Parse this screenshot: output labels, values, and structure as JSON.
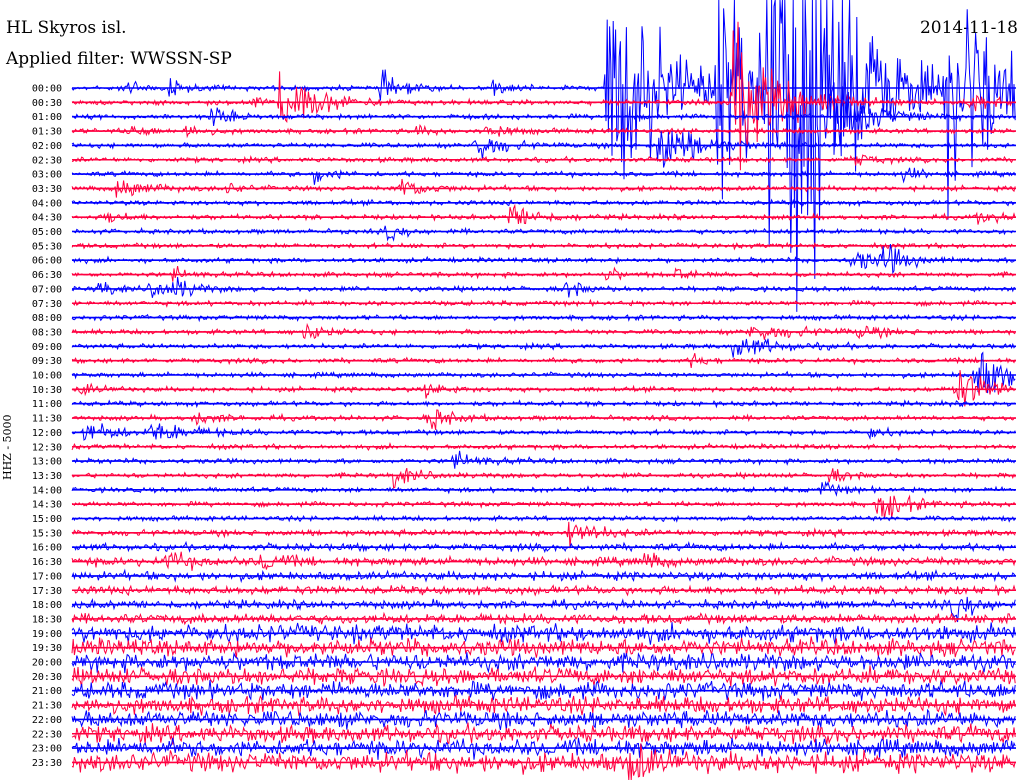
{
  "header": {
    "station": "HL Skyros isl.",
    "filter": "Applied filter: WWSSN-SP",
    "date": "2014-11-18",
    "channel": "HHZ - 5000"
  },
  "colors": {
    "blue": "#0000ff",
    "red": "#ff0040"
  },
  "chart_data": {
    "type": "line",
    "title": "HL Skyros isl.",
    "subtitle": "Applied filter: WWSSN-SP",
    "ylabel": "HHZ - 5000",
    "xlabel": "",
    "trace_interval_minutes": 30,
    "color_cycle": [
      "blue",
      "red"
    ],
    "traces": [
      {
        "label": "00:00",
        "noise": 2
      },
      {
        "label": "00:30",
        "noise": 2
      },
      {
        "label": "01:00",
        "noise": 2
      },
      {
        "label": "01:30",
        "noise": 2
      },
      {
        "label": "02:00",
        "noise": 2
      },
      {
        "label": "02:30",
        "noise": 2
      },
      {
        "label": "03:00",
        "noise": 2
      },
      {
        "label": "03:30",
        "noise": 2
      },
      {
        "label": "04:00",
        "noise": 2
      },
      {
        "label": "04:30",
        "noise": 2
      },
      {
        "label": "05:00",
        "noise": 2
      },
      {
        "label": "05:30",
        "noise": 2
      },
      {
        "label": "06:00",
        "noise": 2
      },
      {
        "label": "06:30",
        "noise": 2
      },
      {
        "label": "07:00",
        "noise": 2
      },
      {
        "label": "07:30",
        "noise": 2
      },
      {
        "label": "08:00",
        "noise": 2
      },
      {
        "label": "08:30",
        "noise": 2
      },
      {
        "label": "09:00",
        "noise": 2
      },
      {
        "label": "09:30",
        "noise": 2
      },
      {
        "label": "10:00",
        "noise": 2
      },
      {
        "label": "10:30",
        "noise": 2
      },
      {
        "label": "11:00",
        "noise": 2
      },
      {
        "label": "11:30",
        "noise": 2
      },
      {
        "label": "12:00",
        "noise": 2
      },
      {
        "label": "12:30",
        "noise": 2
      },
      {
        "label": "13:00",
        "noise": 2
      },
      {
        "label": "13:30",
        "noise": 2
      },
      {
        "label": "14:00",
        "noise": 2
      },
      {
        "label": "14:30",
        "noise": 2
      },
      {
        "label": "15:00",
        "noise": 2
      },
      {
        "label": "15:30",
        "noise": 2.5
      },
      {
        "label": "16:00",
        "noise": 3
      },
      {
        "label": "16:30",
        "noise": 3.5
      },
      {
        "label": "17:00",
        "noise": 3.5
      },
      {
        "label": "17:30",
        "noise": 3.5
      },
      {
        "label": "18:00",
        "noise": 3.5
      },
      {
        "label": "18:30",
        "noise": 4
      },
      {
        "label": "19:00",
        "noise": 7
      },
      {
        "label": "19:30",
        "noise": 7
      },
      {
        "label": "20:00",
        "noise": 7
      },
      {
        "label": "20:30",
        "noise": 7
      },
      {
        "label": "21:00",
        "noise": 7
      },
      {
        "label": "21:30",
        "noise": 7
      },
      {
        "label": "22:00",
        "noise": 7
      },
      {
        "label": "22:30",
        "noise": 7
      },
      {
        "label": "23:00",
        "noise": 7
      },
      {
        "label": "23:30",
        "noise": 8
      }
    ],
    "events": [
      {
        "trace": 0,
        "minute": 1.7,
        "amp": 8,
        "dur": 0.5
      },
      {
        "trace": 0,
        "minute": 3.1,
        "amp": 7,
        "dur": 0.4
      },
      {
        "trace": 0,
        "minute": 9.8,
        "amp": 12,
        "dur": 0.6
      },
      {
        "trace": 0,
        "minute": 13.4,
        "amp": 7,
        "dur": 0.4
      },
      {
        "trace": 0,
        "minute": 17.0,
        "amp": 120,
        "dur": 1.5
      },
      {
        "trace": 0,
        "minute": 20.5,
        "amp": 110,
        "dur": 1.5
      },
      {
        "trace": 0,
        "minute": 22.1,
        "amp": 130,
        "dur": 1.8
      },
      {
        "trace": 0,
        "minute": 22.9,
        "amp": 120,
        "dur": 1.5
      },
      {
        "trace": 0,
        "minute": 27.8,
        "amp": 130,
        "dur": 1.4
      },
      {
        "trace": 1,
        "minute": 6.6,
        "amp": 30,
        "dur": 1.0
      },
      {
        "trace": 1,
        "minute": 5.7,
        "amp": 6,
        "dur": 0.4
      },
      {
        "trace": 1,
        "minute": 21.0,
        "amp": 70,
        "dur": 1.2
      },
      {
        "trace": 1,
        "minute": 28.5,
        "amp": 10,
        "dur": 0.6
      },
      {
        "trace": 2,
        "minute": 4.4,
        "amp": 10,
        "dur": 0.5
      },
      {
        "trace": 2,
        "minute": 24.0,
        "amp": 40,
        "dur": 1.0
      },
      {
        "trace": 3,
        "minute": 1.8,
        "amp": 6,
        "dur": 0.5
      },
      {
        "trace": 3,
        "minute": 3.6,
        "amp": 6,
        "dur": 0.5
      },
      {
        "trace": 3,
        "minute": 10.9,
        "amp": 5,
        "dur": 0.4
      },
      {
        "trace": 3,
        "minute": 13.1,
        "amp": 8,
        "dur": 0.6
      },
      {
        "trace": 4,
        "minute": 12.8,
        "amp": 15,
        "dur": 0.7
      },
      {
        "trace": 4,
        "minute": 18.6,
        "amp": 30,
        "dur": 1.0
      },
      {
        "trace": 5,
        "minute": 24.8,
        "amp": 7,
        "dur": 0.5
      },
      {
        "trace": 6,
        "minute": 7.7,
        "amp": 8,
        "dur": 0.5
      },
      {
        "trace": 6,
        "minute": 26.4,
        "amp": 6,
        "dur": 0.5
      },
      {
        "trace": 7,
        "minute": 1.4,
        "amp": 10,
        "dur": 0.8
      },
      {
        "trace": 7,
        "minute": 4.9,
        "amp": 5,
        "dur": 0.4
      },
      {
        "trace": 7,
        "minute": 10.4,
        "amp": 10,
        "dur": 0.7
      },
      {
        "trace": 9,
        "minute": 1.1,
        "amp": 7,
        "dur": 0.5
      },
      {
        "trace": 9,
        "minute": 13.9,
        "amp": 12,
        "dur": 0.8
      },
      {
        "trace": 9,
        "minute": 28.8,
        "amp": 6,
        "dur": 0.5
      },
      {
        "trace": 10,
        "minute": 10.0,
        "amp": 7,
        "dur": 0.5
      },
      {
        "trace": 12,
        "minute": 24.8,
        "amp": 10,
        "dur": 0.8
      },
      {
        "trace": 12,
        "minute": 25.8,
        "amp": 12,
        "dur": 0.6
      },
      {
        "trace": 13,
        "minute": 3.2,
        "amp": 6,
        "dur": 0.4
      },
      {
        "trace": 13,
        "minute": 17.0,
        "amp": 6,
        "dur": 0.4
      },
      {
        "trace": 13,
        "minute": 19.2,
        "amp": 6,
        "dur": 0.4
      },
      {
        "trace": 14,
        "minute": 0.8,
        "amp": 7,
        "dur": 0.5
      },
      {
        "trace": 14,
        "minute": 2.5,
        "amp": 8,
        "dur": 0.6
      },
      {
        "trace": 14,
        "minute": 3.2,
        "amp": 8,
        "dur": 0.6
      },
      {
        "trace": 14,
        "minute": 15.7,
        "amp": 8,
        "dur": 0.5
      },
      {
        "trace": 17,
        "minute": 7.4,
        "amp": 8,
        "dur": 0.5
      },
      {
        "trace": 17,
        "minute": 21.5,
        "amp": 7,
        "dur": 1.5
      },
      {
        "trace": 17,
        "minute": 25.0,
        "amp": 5,
        "dur": 0.6
      },
      {
        "trace": 18,
        "minute": 21.0,
        "amp": 10,
        "dur": 1.2
      },
      {
        "trace": 19,
        "minute": 19.7,
        "amp": 6,
        "dur": 0.4
      },
      {
        "trace": 20,
        "minute": 28.7,
        "amp": 25,
        "dur": 1.0
      },
      {
        "trace": 21,
        "minute": 0.3,
        "amp": 6,
        "dur": 0.4
      },
      {
        "trace": 21,
        "minute": 11.2,
        "amp": 6,
        "dur": 0.6
      },
      {
        "trace": 21,
        "minute": 28.0,
        "amp": 20,
        "dur": 1.0
      },
      {
        "trace": 23,
        "minute": 3.8,
        "amp": 5,
        "dur": 0.8
      },
      {
        "trace": 23,
        "minute": 11.3,
        "amp": 12,
        "dur": 0.6
      },
      {
        "trace": 24,
        "minute": 0.4,
        "amp": 8,
        "dur": 1.0
      },
      {
        "trace": 24,
        "minute": 2.5,
        "amp": 8,
        "dur": 1.2
      },
      {
        "trace": 24,
        "minute": 25.3,
        "amp": 6,
        "dur": 0.4
      },
      {
        "trace": 26,
        "minute": 12.1,
        "amp": 7,
        "dur": 0.8
      },
      {
        "trace": 27,
        "minute": 10.2,
        "amp": 10,
        "dur": 0.6
      },
      {
        "trace": 27,
        "minute": 24.1,
        "amp": 6,
        "dur": 0.5
      },
      {
        "trace": 28,
        "minute": 23.8,
        "amp": 7,
        "dur": 0.5
      },
      {
        "trace": 29,
        "minute": 25.6,
        "amp": 15,
        "dur": 0.8
      },
      {
        "trace": 31,
        "minute": 15.8,
        "amp": 12,
        "dur": 0.7
      },
      {
        "trace": 33,
        "minute": 3.0,
        "amp": 8,
        "dur": 0.6
      },
      {
        "trace": 33,
        "minute": 6.0,
        "amp": 8,
        "dur": 0.6
      },
      {
        "trace": 33,
        "minute": 18.2,
        "amp": 8,
        "dur": 0.4
      },
      {
        "trace": 36,
        "minute": 28.0,
        "amp": 12,
        "dur": 0.7
      },
      {
        "trace": 47,
        "minute": 17.7,
        "amp": 20,
        "dur": 0.5
      }
    ]
  }
}
